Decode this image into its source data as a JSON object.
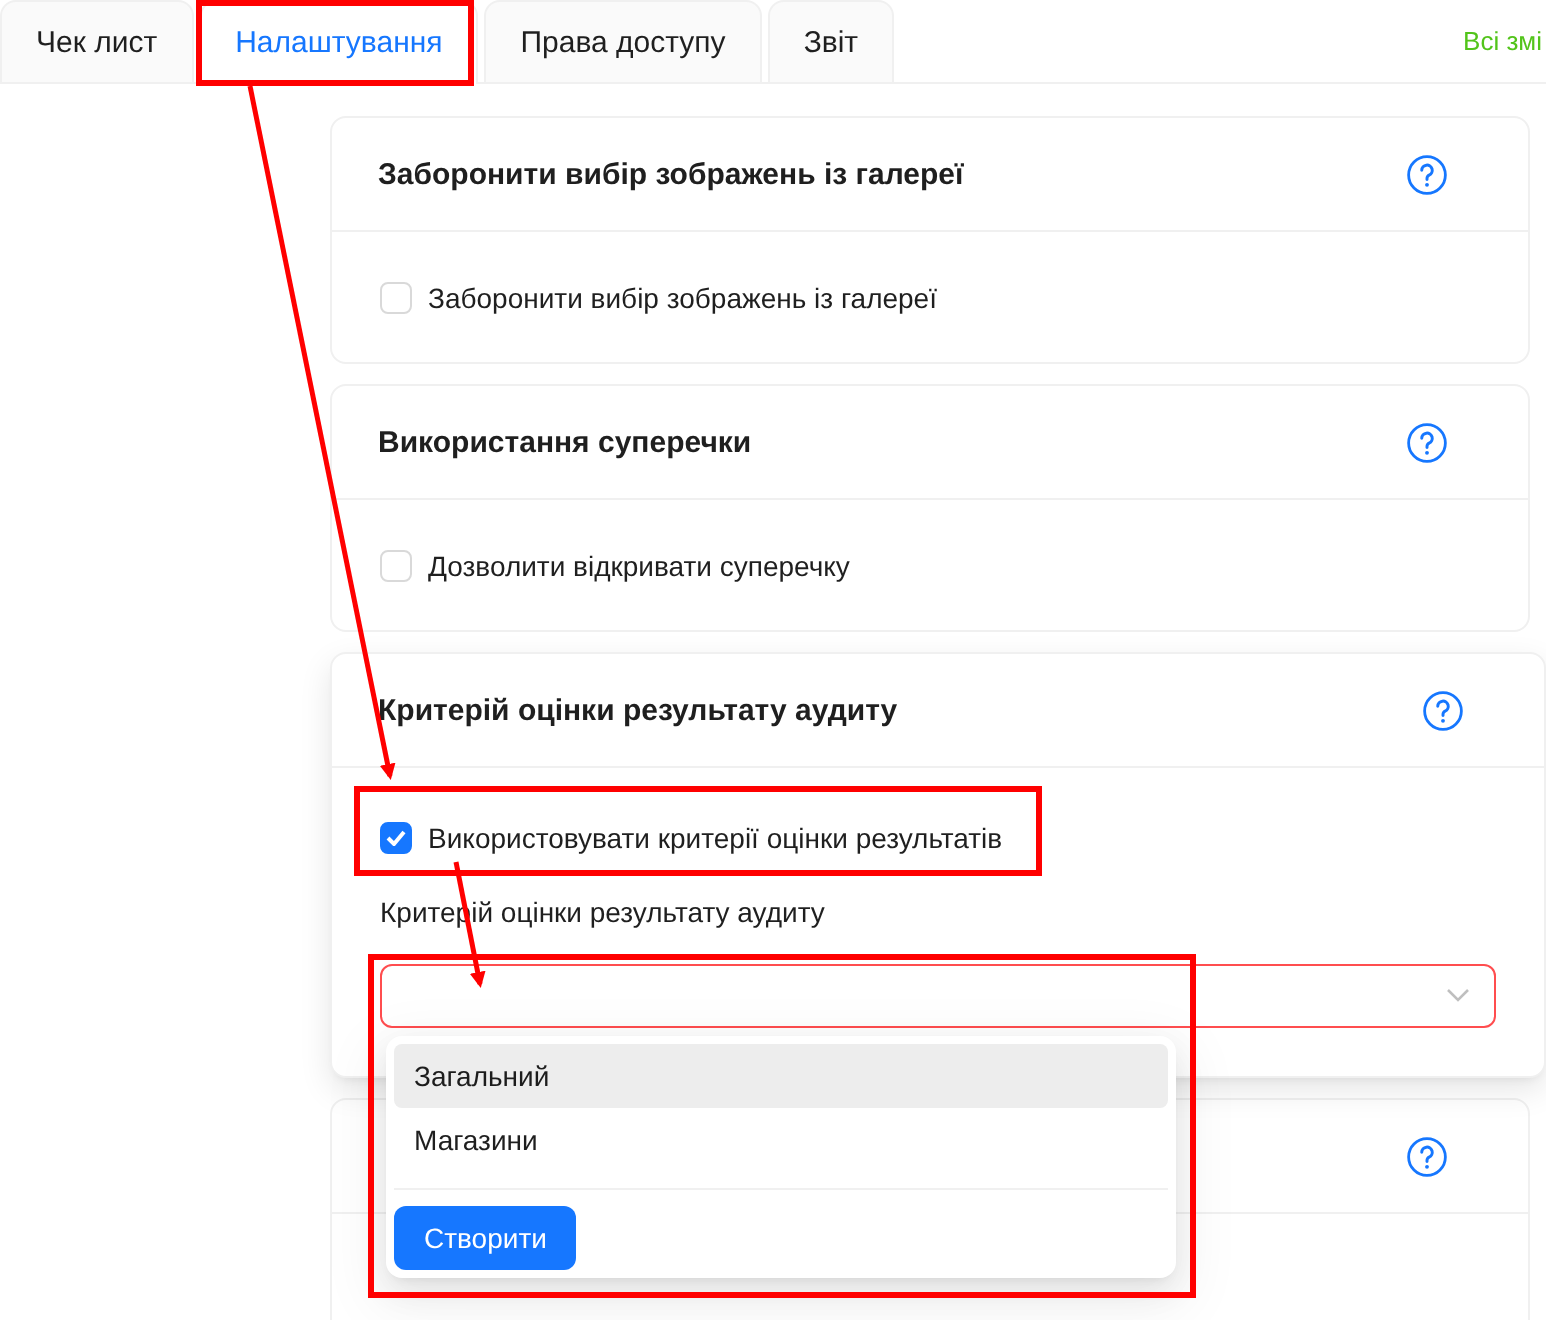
{
  "tabs": [
    {
      "label": "Чек лист",
      "selected": false
    },
    {
      "label": "Налаштування",
      "selected": true
    },
    {
      "label": "Права доступу",
      "selected": false
    },
    {
      "label": "Звіт",
      "selected": false
    }
  ],
  "save_status": "Всі змі",
  "sections": [
    {
      "title": "Заборонити вибір зображень із галереї",
      "raised": false,
      "checkbox": {
        "label": "Заборонити вибір зображень із галереї",
        "checked": false
      }
    },
    {
      "title": "Використання суперечки",
      "raised": false,
      "checkbox": {
        "label": "Дозволити відкривати суперечку",
        "checked": false
      }
    },
    {
      "title": "Критерій оцінки результату аудиту",
      "raised": true,
      "checkbox": {
        "label": "Використовувати критерії оцінки результатів",
        "checked": true
      },
      "select": {
        "label": "Критерій оцінки результату аудиту",
        "error": true,
        "open": true,
        "options": [
          {
            "label": "Загальний",
            "selected": true
          },
          {
            "label": "Магазини",
            "selected": false
          }
        ],
        "create_button": "Створити"
      }
    },
    {
      "raised": false
    }
  ]
}
